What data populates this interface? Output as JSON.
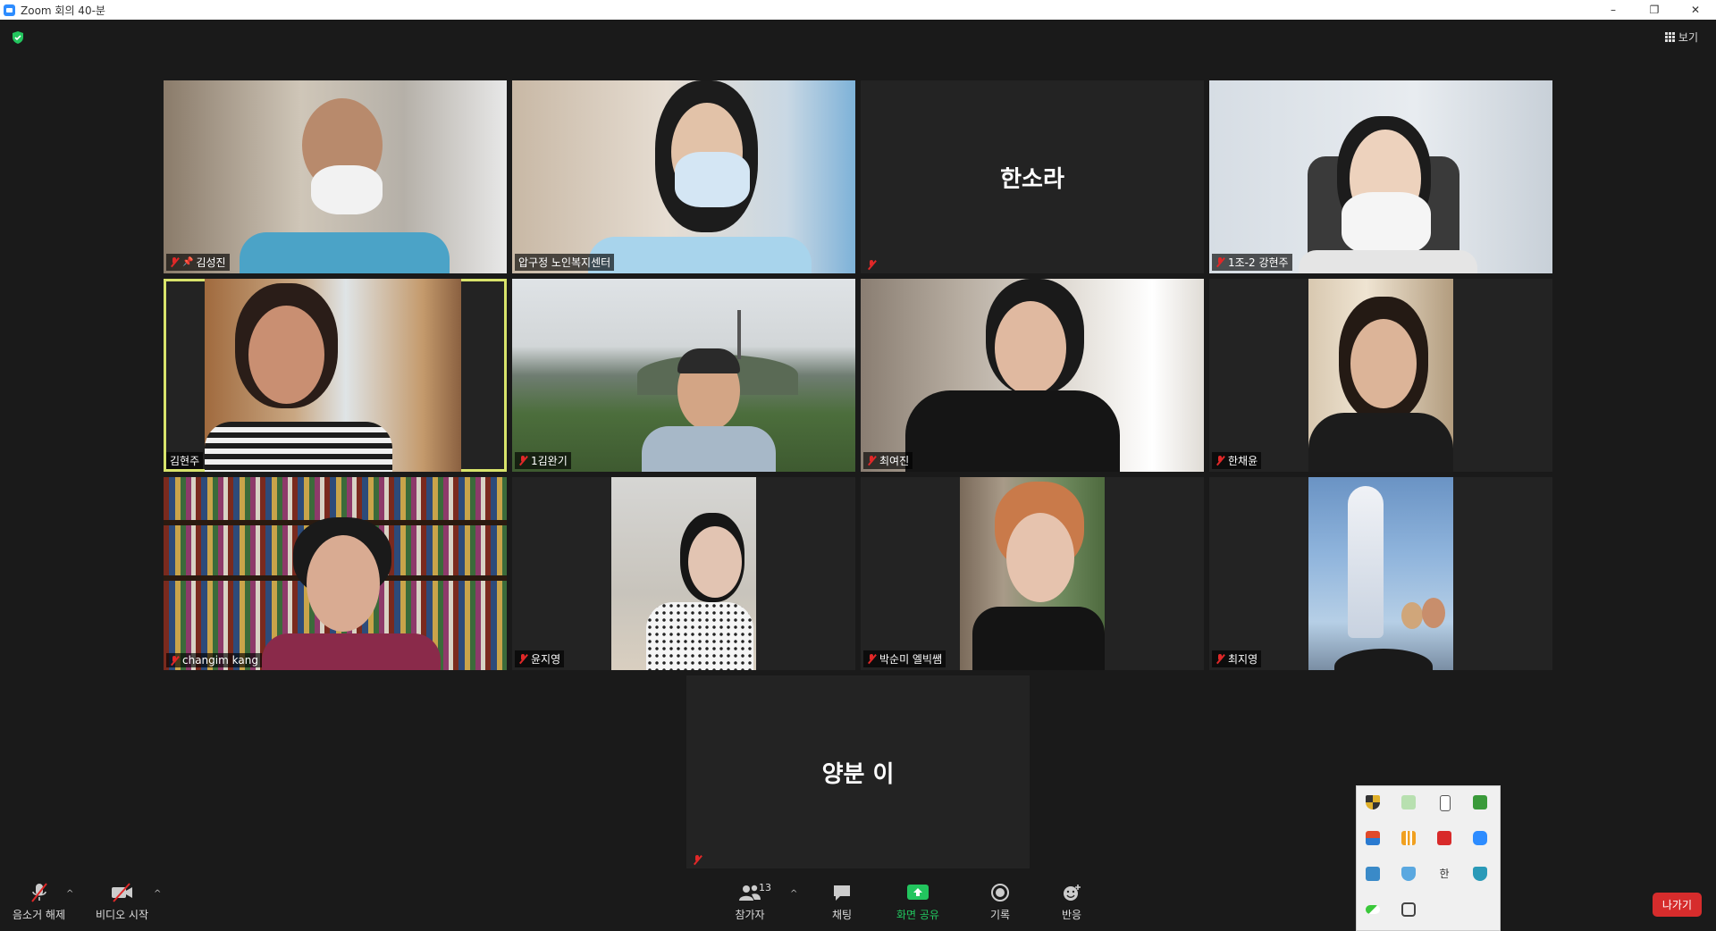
{
  "window": {
    "title": "Zoom 회의 40-분",
    "minimize": "–",
    "restore": "❐",
    "close": "✕"
  },
  "top": {
    "view_label": "보기"
  },
  "participants": [
    {
      "name": "김성진",
      "pinned": true,
      "muted": true
    },
    {
      "name": "압구정 노인복지센터",
      "muted": false
    },
    {
      "name": "한소라",
      "muted": true,
      "video_off": true
    },
    {
      "name": "1조-2 강현주",
      "muted": true
    },
    {
      "name": "김현주",
      "muted": false,
      "active_speaker": true
    },
    {
      "name": "1김완기",
      "muted": true
    },
    {
      "name": "최여진",
      "muted": true
    },
    {
      "name": "한채윤",
      "muted": true
    },
    {
      "name": "changim kang",
      "muted": true
    },
    {
      "name": "윤지영",
      "muted": true
    },
    {
      "name": "박순미 엘빅쌤",
      "muted": true
    },
    {
      "name": "최지영",
      "muted": true
    },
    {
      "name": "양분 이",
      "muted": true,
      "video_off": true
    }
  ],
  "toolbar": {
    "unmute_label": "음소거 해제",
    "start_video_label": "비디오 시작",
    "participants_label": "참가자",
    "participants_count": "13",
    "chat_label": "채팅",
    "share_label": "화면 공유",
    "record_label": "기록",
    "reactions_label": "반응",
    "leave_label": "나가기"
  },
  "tray_icons": [
    "shield-defender-icon",
    "sync-check-icon",
    "usb-icon",
    "ml-app-icon",
    "app-box-icon",
    "chart-app-icon",
    "pdf-app-icon",
    "zoom-tray-icon",
    "network-icon",
    "security-icon",
    "hangul-ime-icon",
    "shield-app-icon",
    "pill-app-icon",
    "clipboard-icon"
  ],
  "colors": {
    "background": "#1a1a1a",
    "tile": "#232323",
    "active_speaker_border": "#d8e36b",
    "leave_button": "#d62c2c",
    "share_green": "#22c55e",
    "muted_red": "#e02828"
  }
}
